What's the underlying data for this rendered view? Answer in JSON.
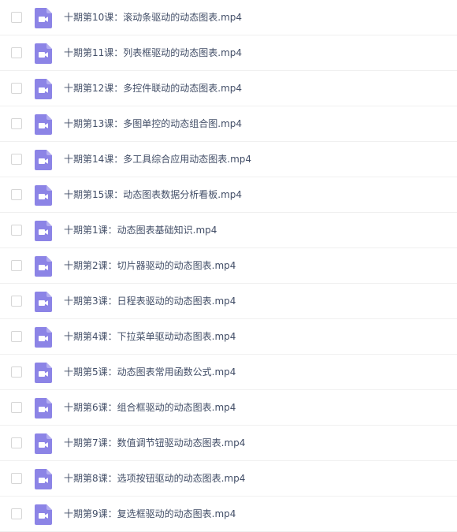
{
  "file_list": {
    "icon": "video-file-icon",
    "icon_color": "#8c84e6",
    "items": [
      {
        "name": "十期第10课：滚动条驱动的动态图表.mp4"
      },
      {
        "name": "十期第11课：列表框驱动的动态图表.mp4"
      },
      {
        "name": "十期第12课：多控件联动的动态图表.mp4"
      },
      {
        "name": "十期第13课：多图单控的动态组合图.mp4"
      },
      {
        "name": "十期第14课：多工具综合应用动态图表.mp4"
      },
      {
        "name": "十期第15课：动态图表数据分析看板.mp4"
      },
      {
        "name": "十期第1课：动态图表基础知识.mp4"
      },
      {
        "name": "十期第2课：切片器驱动的动态图表.mp4"
      },
      {
        "name": "十期第3课：日程表驱动的动态图表.mp4"
      },
      {
        "name": "十期第4课：下拉菜单驱动动态图表.mp4"
      },
      {
        "name": "十期第5课：动态图表常用函数公式.mp4"
      },
      {
        "name": "十期第6课：组合框驱动的动态图表.mp4"
      },
      {
        "name": "十期第7课：数值调节钮驱动动态图表.mp4"
      },
      {
        "name": "十期第8课：选项按钮驱动的动态图表.mp4"
      },
      {
        "name": "十期第9课：复选框驱动的动态图表.mp4"
      }
    ]
  }
}
